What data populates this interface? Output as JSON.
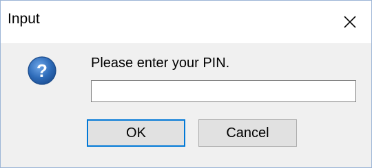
{
  "window": {
    "title": "Input"
  },
  "dialog": {
    "prompt": "Please enter your PIN.",
    "pin_value": "",
    "icon": "question-icon"
  },
  "buttons": {
    "ok_label": "OK",
    "cancel_label": "Cancel"
  },
  "icons": {
    "close": "close-icon"
  },
  "colors": {
    "accent": "#0078d7",
    "question_icon": "#2e6bb8",
    "window_background": "#f0f0f0",
    "titlebar_background": "#ffffff"
  }
}
